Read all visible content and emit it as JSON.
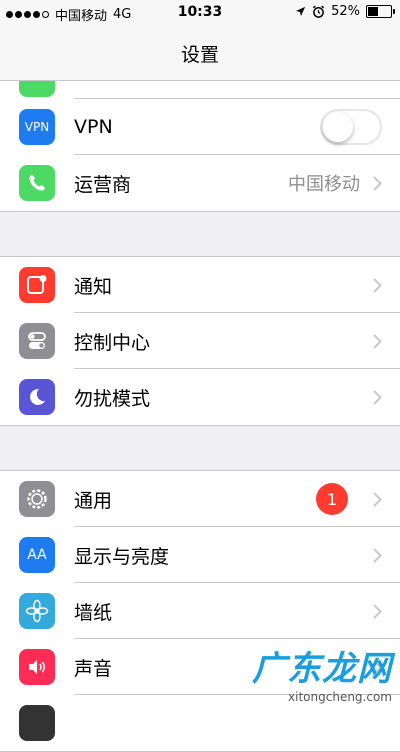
{
  "status_bar": {
    "carrier": "中国移动",
    "network": "4G",
    "time": "10:33",
    "battery_percent": "52%",
    "battery_level": 0.52
  },
  "nav": {
    "title": "设置"
  },
  "rows": {
    "vpn": {
      "label": "VPN",
      "icon_text": "VPN",
      "toggle_on": false
    },
    "carrier": {
      "label": "运营商",
      "detail": "中国移动"
    },
    "notifications": {
      "label": "通知"
    },
    "control_center": {
      "label": "控制中心"
    },
    "do_not_disturb": {
      "label": "勿扰模式"
    },
    "general": {
      "label": "通用",
      "badge": "1"
    },
    "display": {
      "label": "显示与亮度",
      "icon_text": "AA"
    },
    "wallpaper": {
      "label": "墙纸"
    },
    "sounds": {
      "label": "声音"
    }
  },
  "colors": {
    "vpn": "#1f7cf0",
    "phone": "#4cd964",
    "notifications": "#ff3b30",
    "control": "#8e8e93",
    "dnd": "#5856d6",
    "general": "#8e8e93",
    "display": "#1f7cf0",
    "wallpaper": "#34aadc",
    "sounds": "#ff2d55"
  },
  "watermark": {
    "text": "广东龙网",
    "sub": "xitongcheng.com"
  }
}
